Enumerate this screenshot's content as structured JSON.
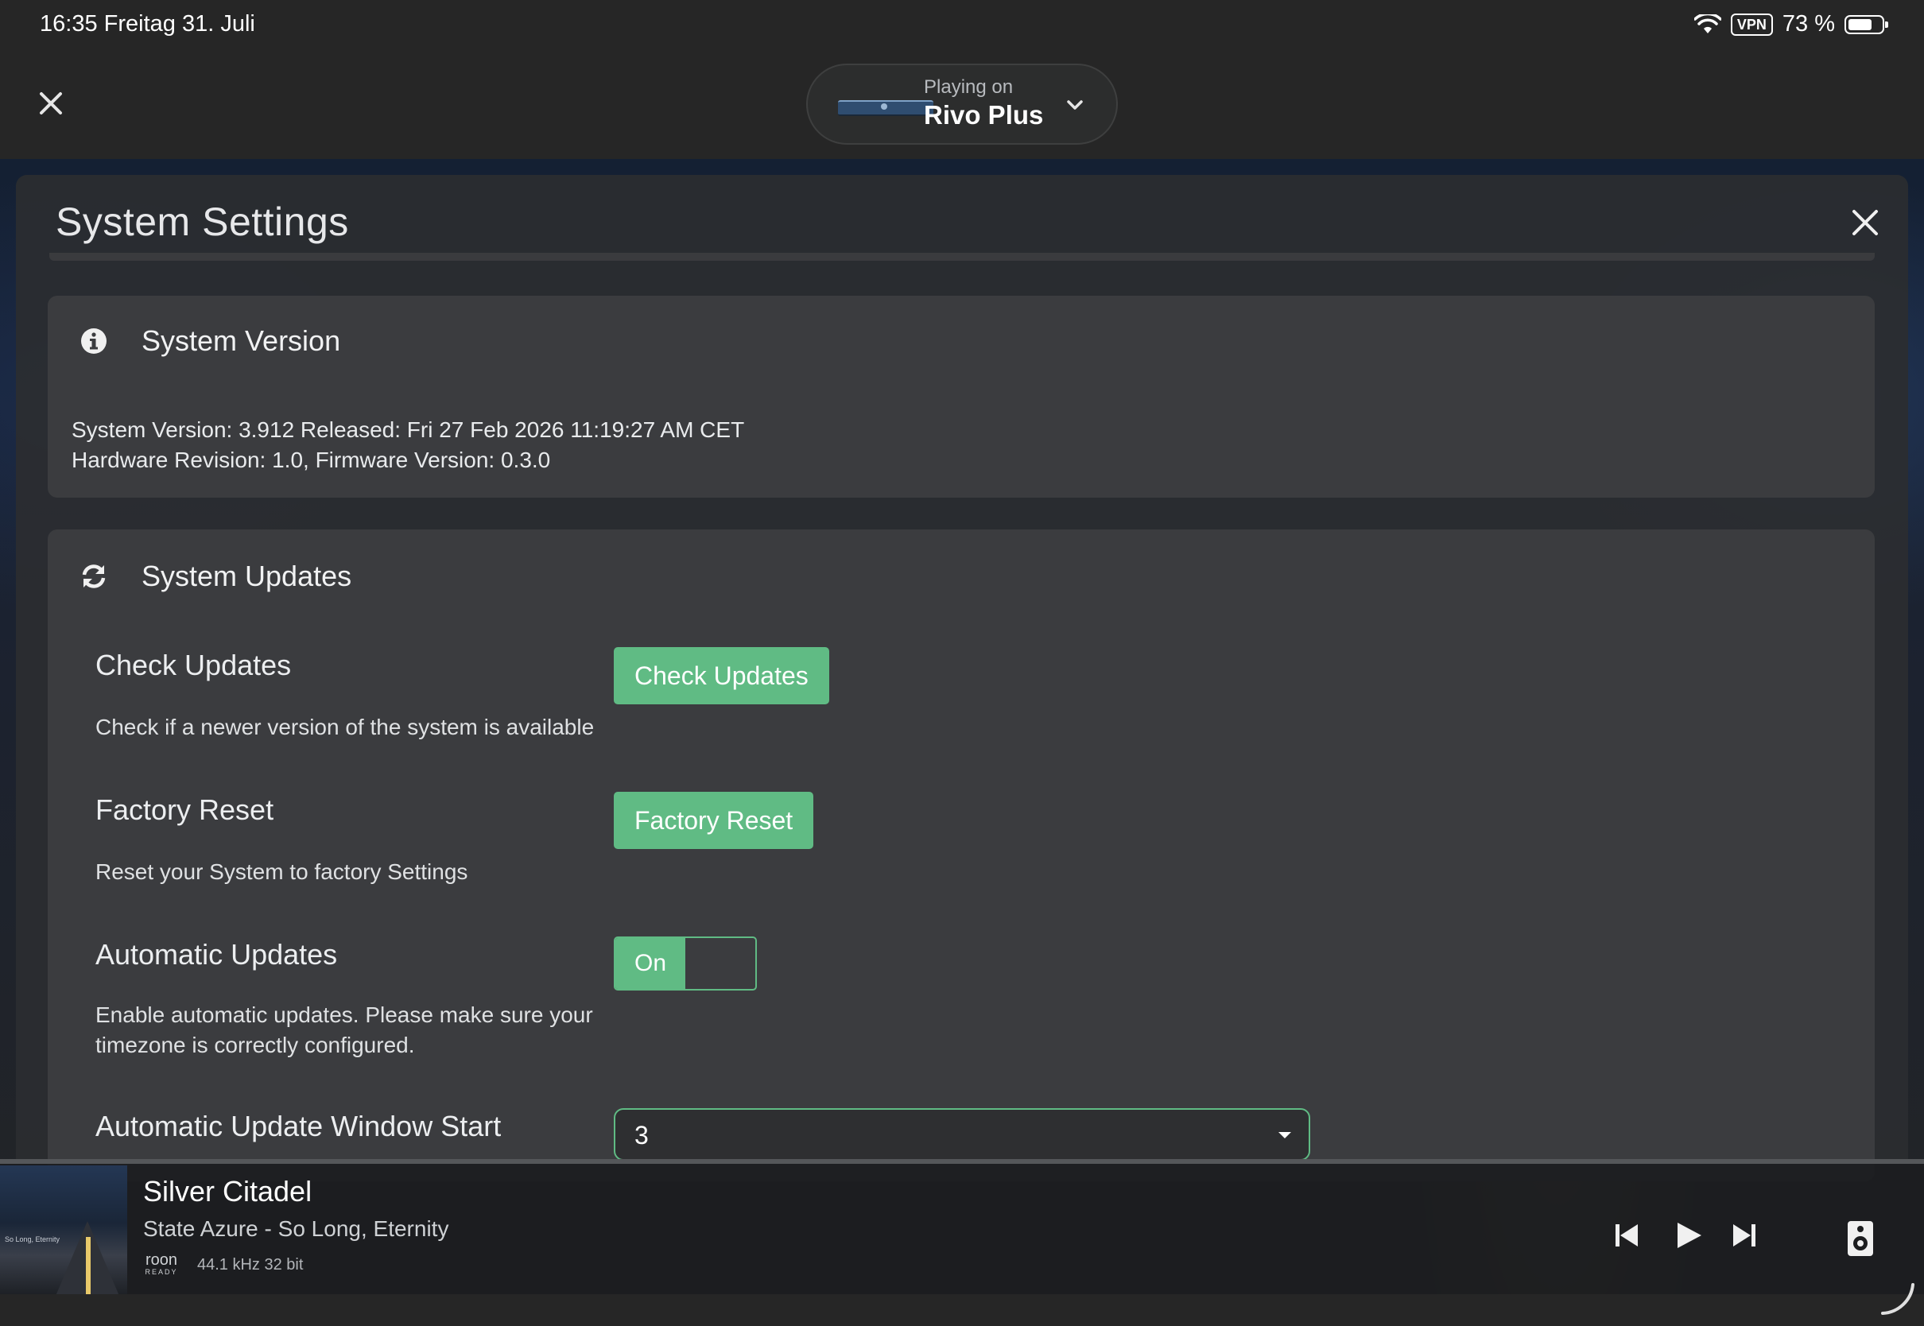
{
  "status_bar": {
    "time_date": "16:35   Freitag 31. Juli",
    "vpn": "VPN",
    "battery_text": "73 %",
    "battery_level": 0.73
  },
  "top_bar": {
    "playing_label": "Playing on",
    "zone_name": "Rivo Plus"
  },
  "panel": {
    "title": "System Settings"
  },
  "system_version": {
    "title": "System Version",
    "line1": "System Version: 3.912 Released: Fri 27 Feb 2026 11:19:27 AM CET",
    "line2": "Hardware Revision: 1.0, Firmware Version: 0.3.0"
  },
  "system_updates": {
    "title": "System Updates",
    "check": {
      "label": "Check Updates",
      "description": "Check if a newer version of the system is available",
      "button": "Check Updates"
    },
    "factory_reset": {
      "label": "Factory Reset",
      "description": "Reset your System to factory Settings",
      "button": "Factory Reset"
    },
    "auto_updates": {
      "label": "Automatic Updates",
      "description": "Enable automatic updates. Please make sure your timezone is correctly configured.",
      "toggle_text": "On"
    },
    "window_start": {
      "label": "Automatic Update Window Start",
      "value": "3"
    }
  },
  "player": {
    "track_title": "Silver Citadel",
    "track_artist": "State Azure - So Long, Eternity",
    "roon_logo_top": "roon",
    "roon_logo_bottom": "READY",
    "format": "44.1 kHz 32 bit",
    "cover_text": "So Long, Eternity"
  },
  "colors": {
    "accent": "#60bb84",
    "panel": "#2b2d30",
    "card": "#3b3c3f"
  }
}
